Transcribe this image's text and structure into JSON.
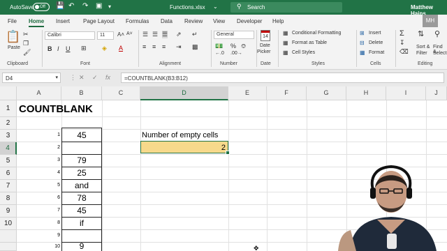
{
  "titlebar": {
    "autosave_label": "AutoSave",
    "autosave_state": "Off",
    "filename": "Functions.xlsx",
    "search_placeholder": "Search",
    "user": "Matthew Hains"
  },
  "menu": [
    "File",
    "Home",
    "Insert",
    "Page Layout",
    "Formulas",
    "Data",
    "Review",
    "View",
    "Developer",
    "Help"
  ],
  "menu_active": "Home",
  "ribbon": {
    "clipboard": {
      "paste": "Paste",
      "label": "Clipboard"
    },
    "font": {
      "name": "Calibri",
      "size": "11",
      "label": "Font"
    },
    "alignment": {
      "label": "Alignment"
    },
    "number": {
      "format": "General",
      "label": "Number"
    },
    "date": {
      "day": "14",
      "picker_line1": "Date",
      "picker_line2": "Picker",
      "label": "Date"
    },
    "styles": {
      "conditional": "Conditional Formatting",
      "format_table": "Format as Table",
      "cell_styles": "Cell Styles",
      "label": "Styles"
    },
    "cells": {
      "insert": "Insert",
      "delete": "Delete",
      "format": "Format",
      "label": "Cells"
    },
    "editing": {
      "sort": "Sort &",
      "filter": "Filter",
      "find": "Find &",
      "select": "Select",
      "label": "Editing"
    }
  },
  "formula_bar": {
    "name_box": "D4",
    "formula": "=COUNTBLANK(B3:B12)"
  },
  "columns": [
    "A",
    "B",
    "C",
    "D",
    "E",
    "F",
    "G",
    "H",
    "I",
    "J"
  ],
  "rows": [
    "1",
    "2",
    "3",
    "4",
    "5",
    "6",
    "7",
    "8",
    "9",
    "10"
  ],
  "cells": {
    "A1": "COUNTBLANK",
    "D3": "Number of empty cells",
    "D4": "2",
    "b_values": [
      "45",
      "",
      "79",
      "25",
      "and",
      "78",
      "45",
      "if",
      "",
      "9"
    ],
    "indices": [
      "1",
      "2",
      "3",
      "4",
      "5",
      "6",
      "7",
      "8",
      "9",
      "10"
    ]
  },
  "watermark": "MH"
}
